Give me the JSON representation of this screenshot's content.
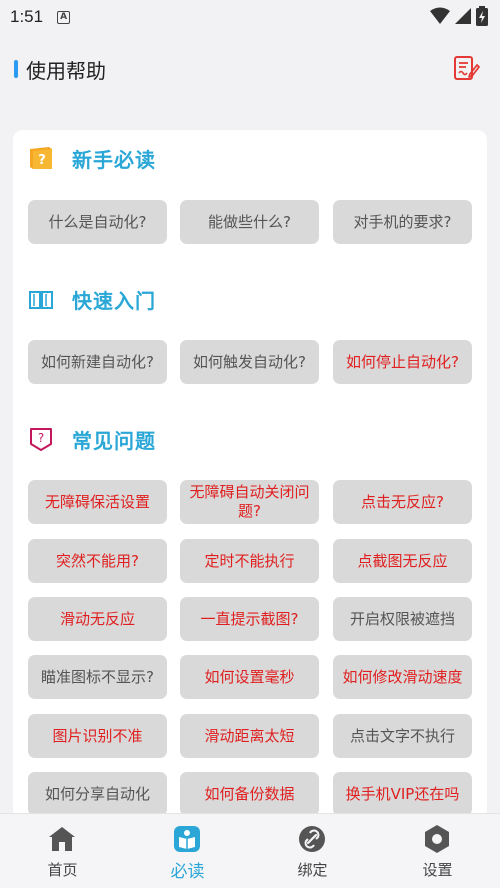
{
  "status_bar": {
    "time": "1:51",
    "notif_letter": "A"
  },
  "header": {
    "title": "使用帮助"
  },
  "sections": [
    {
      "title": "新手必读",
      "icon": "book-orange-icon",
      "buttons": [
        {
          "label": "什么是自动化?",
          "highlight": false
        },
        {
          "label": "能做些什么?",
          "highlight": false
        },
        {
          "label": "对手机的要求?",
          "highlight": false
        }
      ]
    },
    {
      "title": "快速入门",
      "icon": "open-book-icon",
      "buttons": [
        {
          "label": "如何新建自动化?",
          "highlight": false
        },
        {
          "label": "如何触发自动化?",
          "highlight": false
        },
        {
          "label": "如何停止自动化?",
          "highlight": true
        }
      ]
    },
    {
      "title": "常见问题",
      "icon": "question-badge-icon",
      "buttons": [
        {
          "label": "无障碍保活设置",
          "highlight": true
        },
        {
          "label": "无障碍自动关闭问题?",
          "highlight": true
        },
        {
          "label": "点击无反应?",
          "highlight": true
        },
        {
          "label": "突然不能用?",
          "highlight": true
        },
        {
          "label": "定时不能执行",
          "highlight": true
        },
        {
          "label": "点截图无反应",
          "highlight": true
        },
        {
          "label": "滑动无反应",
          "highlight": true
        },
        {
          "label": "一直提示截图?",
          "highlight": true
        },
        {
          "label": "开启权限被遮挡",
          "highlight": false
        },
        {
          "label": "瞄准图标不显示?",
          "highlight": false
        },
        {
          "label": "如何设置毫秒",
          "highlight": true
        },
        {
          "label": "如何修改滑动速度",
          "highlight": true
        },
        {
          "label": "图片识别不准",
          "highlight": true
        },
        {
          "label": "滑动距离太短",
          "highlight": true
        },
        {
          "label": "点击文字不执行",
          "highlight": false
        },
        {
          "label": "如何分享自动化",
          "highlight": false
        },
        {
          "label": "如何备份数据",
          "highlight": true
        },
        {
          "label": "换手机VIP还在吗",
          "highlight": true
        }
      ]
    }
  ],
  "bottom_nav": [
    {
      "label": "首页",
      "icon": "home-icon",
      "active": false
    },
    {
      "label": "必读",
      "icon": "read-icon",
      "active": true
    },
    {
      "label": "绑定",
      "icon": "link-icon",
      "active": false
    },
    {
      "label": "设置",
      "icon": "settings-icon",
      "active": false
    }
  ],
  "colors": {
    "accent": "#2aa7d6",
    "highlight_text": "#e02020",
    "button_bg": "#d9d9d9",
    "inactive_nav": "#555555"
  }
}
